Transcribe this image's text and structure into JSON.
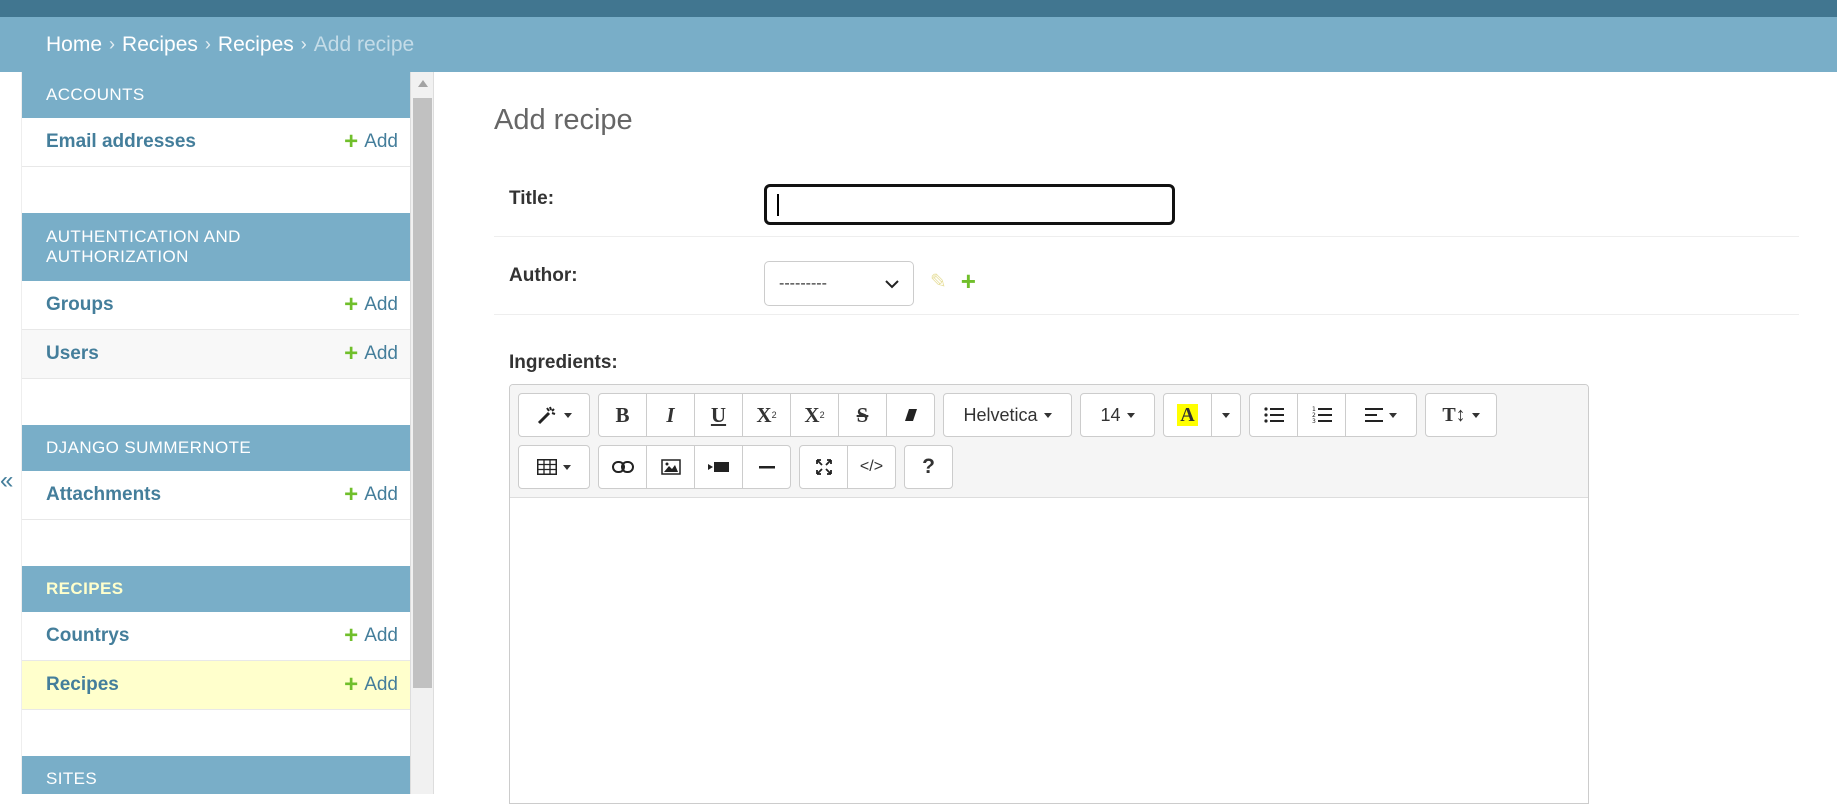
{
  "breadcrumbs": {
    "items": [
      "Home",
      "Recipes",
      "Recipes"
    ],
    "current": "Add recipe",
    "separator": "›"
  },
  "collapse_toggle": "«",
  "sidebar": {
    "add_label": "Add",
    "modules": [
      {
        "caption": "Accounts",
        "models": [
          {
            "name": "Email addresses"
          }
        ]
      },
      {
        "caption": "Authentication and Authorization",
        "models": [
          {
            "name": "Groups"
          },
          {
            "name": "Users"
          }
        ]
      },
      {
        "caption": "Django Summernote",
        "models": [
          {
            "name": "Attachments"
          }
        ]
      },
      {
        "caption": "Recipes",
        "current": true,
        "models": [
          {
            "name": "Countrys"
          },
          {
            "name": "Recipes",
            "selected": true
          }
        ]
      },
      {
        "caption": "Sites",
        "models": []
      }
    ]
  },
  "form": {
    "page_title": "Add recipe",
    "title_label": "Title:",
    "title_value": "",
    "author_label": "Author:",
    "author_selected": "---------",
    "ingredients_label": "Ingredients:"
  },
  "editor": {
    "font_name": "Helvetica",
    "font_size": "14",
    "highlight_letter": "A",
    "highlight_color": "#ffff00",
    "buttons_row1": [
      "magic-wand",
      "bold",
      "italic",
      "underline",
      "superscript",
      "subscript",
      "strikethrough",
      "eraser",
      "font-name",
      "font-size",
      "color",
      "color-dropdown",
      "unordered-list",
      "ordered-list",
      "paragraph-align",
      "line-height"
    ],
    "buttons_row2": [
      "table",
      "link",
      "picture",
      "video",
      "horizontal-rule",
      "fullscreen",
      "code-view",
      "help"
    ],
    "labels": {
      "bold": "B",
      "italic": "I",
      "underline": "U",
      "superscript": "X",
      "subscript": "X",
      "strike": "S",
      "help": "?",
      "code": "</>"
    }
  },
  "colors": {
    "header": "#417690",
    "breadcrumb_bar": "#79aec8",
    "link": "#447e9b",
    "add_plus": "#70bf2b",
    "selected_row": "#ffffcc"
  }
}
